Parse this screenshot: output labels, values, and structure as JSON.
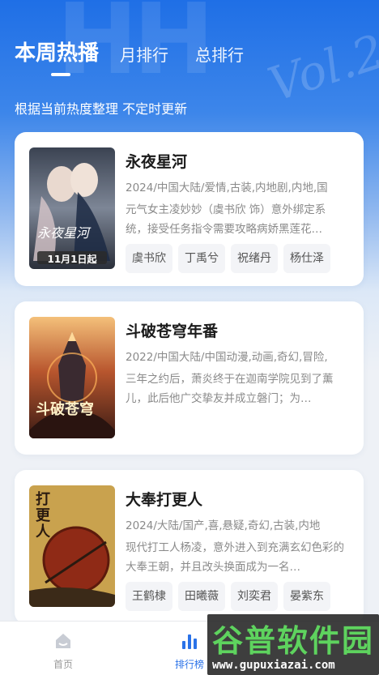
{
  "tabs": [
    {
      "label": "本周热播",
      "active": true
    },
    {
      "label": "月排行",
      "active": false
    },
    {
      "label": "总排行",
      "active": false
    }
  ],
  "subtitle": "根据当前热度整理 不定时更新",
  "cards": [
    {
      "title": "永夜星河",
      "meta": "2024/中国大陆/爱情,古装,内地剧,内地,国",
      "desc": "元气女主凌妙妙（虞书欣 饰）意外绑定系统，接受任务指令需要攻略病娇黑莲花…",
      "poster_text": "11月1日起",
      "poster_title": "永夜星河",
      "cast": [
        "虞书欣",
        "丁禹兮",
        "祝绪丹",
        "杨仕泽"
      ]
    },
    {
      "title": "斗破苍穹年番",
      "meta": "2022/中国大陆/中国动漫,动画,奇幻,冒险,",
      "desc": "三年之约后，萧炎终于在迦南学院见到了薰儿，此后他广交挚友并成立磐门；为…",
      "poster_title": "斗破苍穹",
      "cast": []
    },
    {
      "title": "大奉打更人",
      "meta": "2024/大陆/国产,喜,悬疑,奇幻,古装,内地",
      "desc": "现代打工人杨凌，意外进入到充满玄幻色彩的大奉王朝，并且改头换面成为一名…",
      "poster_title": "打更人",
      "cast": [
        "王鹤棣",
        "田曦薇",
        "刘奕君",
        "晏紫东"
      ]
    }
  ],
  "nav": [
    {
      "label": "首页",
      "icon": "home-icon",
      "active": false
    },
    {
      "label": "排行榜",
      "icon": "bar-chart-icon",
      "active": true
    }
  ],
  "watermark": {
    "title": "谷普软件园",
    "url": "www.gupuxiazai.com"
  },
  "colors": {
    "accent": "#2a72e8",
    "hero_top": "#1f6fe6"
  }
}
